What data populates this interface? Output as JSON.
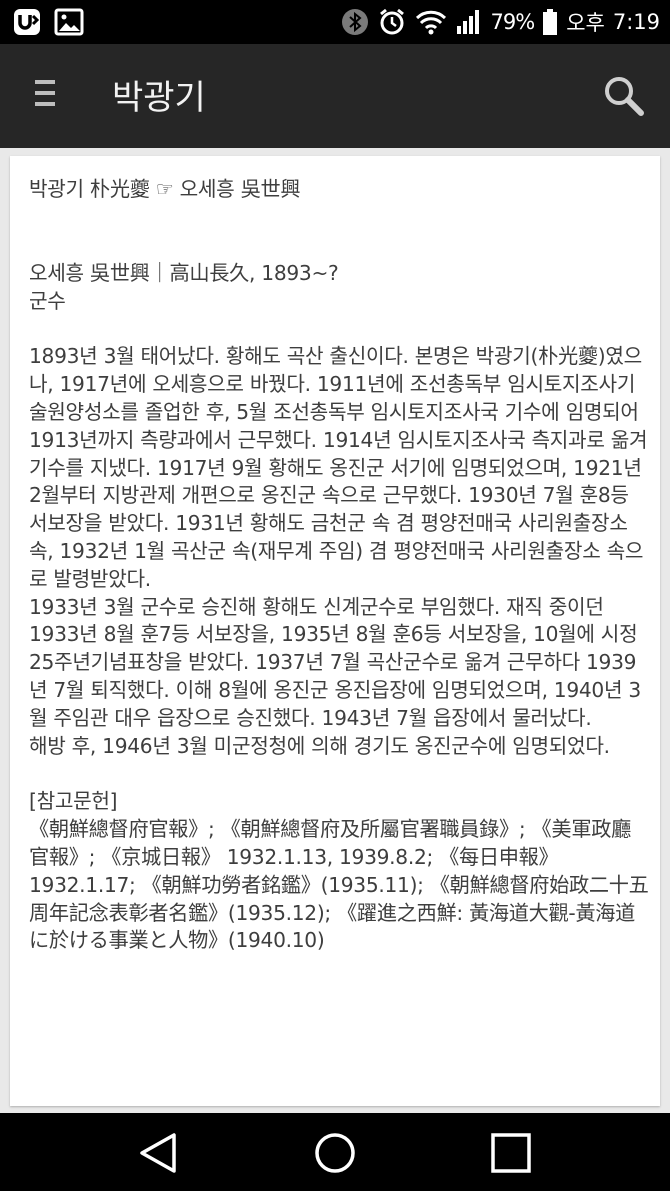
{
  "status": {
    "battery_percent": "79%",
    "period": "오후",
    "time": "7:19"
  },
  "app_bar": {
    "title": "박광기"
  },
  "article": {
    "redirect": "박광기 朴光夔 ☞ 오세흥 吳世興",
    "heading": "오세흥 吳世興｜高山長久, 1893~?",
    "role": "군수",
    "biography": "1893년 3월 태어났다. 황해도 곡산 출신이다. 본명은 박광기(朴光夔)였으나, 1917년에 오세흥으로 바꿨다. 1911년에 조선총독부 임시토지조사기술원양성소를 졸업한 후, 5월 조선총독부 임시토지조사국 기수에 임명되어 1913년까지 측량과에서 근무했다. 1914년 임시토지조사국 측지과로 옮겨 기수를 지냈다. 1917년 9월 황해도 옹진군 서기에 임명되었으며, 1921년 2월부터 지방관제 개편으로 옹진군 속으로 근무했다. 1930년 7월 훈8등 서보장을 받았다. 1931년 황해도 금천군 속 겸 평양전매국 사리원출장소 속, 1932년 1월 곡산군 속(재무계 주임) 겸 평양전매국 사리원출장소 속으로 발령받았다.\n1933년 3월 군수로 승진해 황해도 신계군수로 부임했다. 재직 중이던 1933년 8월 훈7등 서보장을, 1935년 8월 훈6등 서보장을, 10월에 시정25주년기념표창을 받았다. 1937년 7월 곡산군수로 옮겨 근무하다 1939년 7월 퇴직했다. 이해 8월에 옹진군 옹진읍장에 임명되었으며, 1940년 3월 주임관 대우 읍장으로 승진했다. 1943년 7월 읍장에서 물러났다.\n해방 후, 1946년 3월 미군정청에 의해 경기도 옹진군수에 임명되었다.",
    "references_title": "[참고문헌]",
    "references": "《朝鮮總督府官報》; 《朝鮮總督府及所屬官署職員錄》; 《美軍政廳官報》; 《京城日報》 1932.1.13, 1939.8.2; 《每日申報》 1932.1.17; 《朝鮮功勞者銘鑑》(1935.11); 《朝鮮總督府始政二十五周年記念表彰者名鑑》(1935.12); 《躍進之西鮮: 黃海道大觀-黃海道に於ける事業と人物》(1940.10)"
  }
}
